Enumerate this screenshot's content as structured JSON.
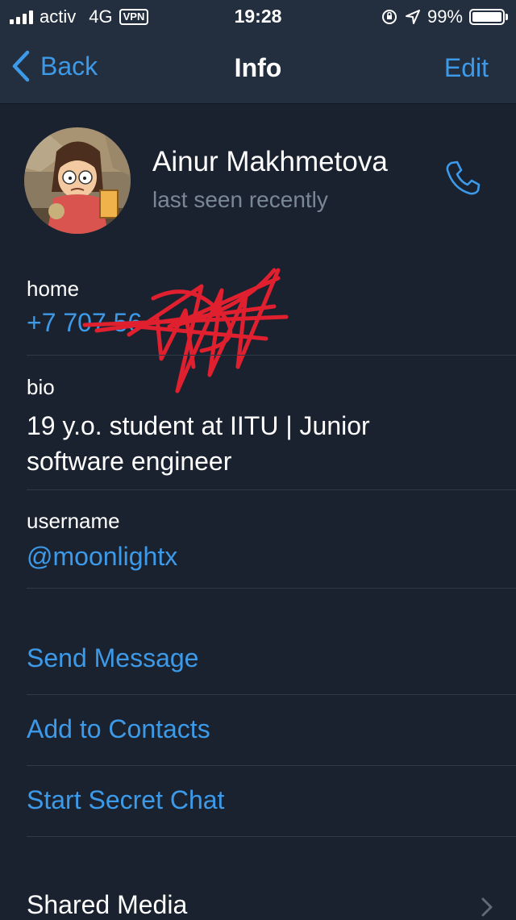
{
  "status_bar": {
    "carrier": "activ",
    "network": "4G",
    "vpn": "VPN",
    "time": "19:28",
    "battery_text": "99%",
    "battery_level": 0.99
  },
  "nav": {
    "back_label": "Back",
    "title": "Info",
    "edit_label": "Edit"
  },
  "profile": {
    "name": "Ainur Makhmetova",
    "last_seen": "last seen recently"
  },
  "fields": {
    "home_label": "home",
    "home_phone": "+7 707 56 ",
    "bio_label": "bio",
    "bio_line1": "19 y.o. student at IITU | Junior",
    "bio_line2": "software engineer",
    "username_label": "username",
    "username": "@moonlightx"
  },
  "actions": {
    "send_message": "Send Message",
    "add_to_contacts": "Add to Contacts",
    "start_secret_chat": "Start Secret Chat",
    "shared_media": "Shared Media"
  },
  "colors": {
    "accent": "#3d9ae8",
    "background": "#1a2230",
    "header": "#232f3e",
    "muted": "#7a8796",
    "scribble": "#e0202e"
  },
  "icons": {
    "back": "chevron-left-icon",
    "call": "phone-icon",
    "shared_media": "chevron-right-icon"
  }
}
